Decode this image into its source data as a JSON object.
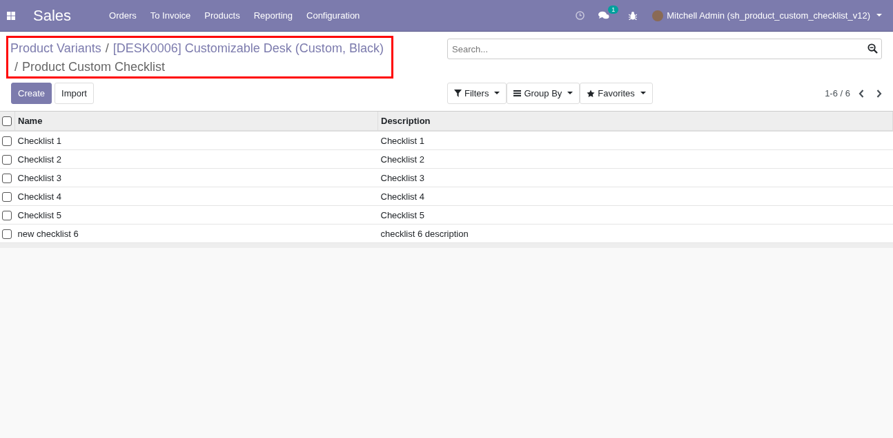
{
  "navbar": {
    "app_name": "Sales",
    "menu": [
      "Orders",
      "To Invoice",
      "Products",
      "Reporting",
      "Configuration"
    ],
    "chat_badge": "1",
    "user": "Mitchell Admin (sh_product_custom_checklist_v12)"
  },
  "breadcrumb": {
    "highlighted": true,
    "separator": "/",
    "items": [
      {
        "label": "Product Variants",
        "kind": "link"
      },
      {
        "label": "[DESK0006] Customizable Desk (Custom, Black)",
        "kind": "link"
      },
      {
        "label": "Product Custom Checklist",
        "kind": "current"
      }
    ]
  },
  "buttons": [
    {
      "label": "Create",
      "kind": "primary"
    },
    {
      "label": "Import",
      "kind": "secondary"
    }
  ],
  "search": {
    "placeholder": "Search..."
  },
  "search_options": [
    {
      "label": "Filters",
      "kind": "filter"
    },
    {
      "label": "Group By",
      "kind": "group"
    },
    {
      "label": "Favorites",
      "kind": "star"
    }
  ],
  "pager": "1-6 / 6",
  "table": {
    "select_all_checked": false,
    "columns": [
      "Name",
      "Description"
    ],
    "rows": [
      {
        "name": "Checklist 1",
        "description": "Checklist 1",
        "checked": false
      },
      {
        "name": "Checklist 2",
        "description": "Checklist 2",
        "checked": false
      },
      {
        "name": "Checklist 3",
        "description": "Checklist 3",
        "checked": false
      },
      {
        "name": "Checklist 4",
        "description": "Checklist 4",
        "checked": false
      },
      {
        "name": "Checklist 5",
        "description": "Checklist 5",
        "checked": false
      },
      {
        "name": "new checklist 6",
        "description": "checklist 6 description",
        "checked": false
      }
    ]
  }
}
